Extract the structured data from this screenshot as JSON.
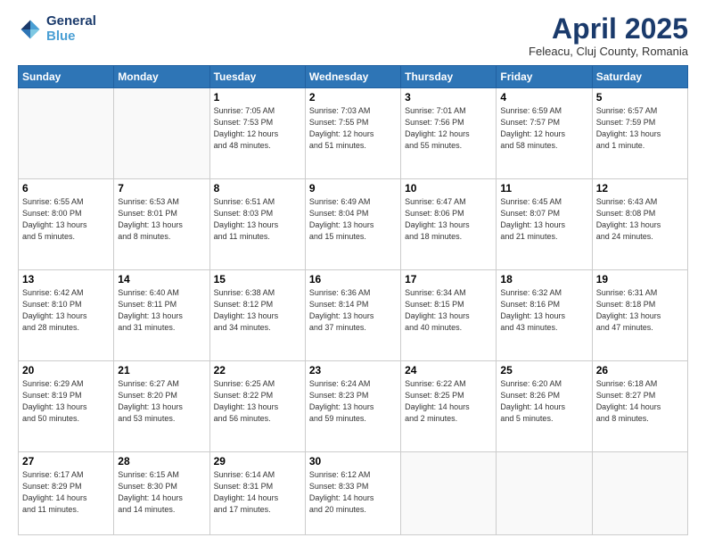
{
  "header": {
    "logo_line1": "General",
    "logo_line2": "Blue",
    "month_title": "April 2025",
    "location": "Feleacu, Cluj County, Romania"
  },
  "weekdays": [
    "Sunday",
    "Monday",
    "Tuesday",
    "Wednesday",
    "Thursday",
    "Friday",
    "Saturday"
  ],
  "weeks": [
    [
      {
        "day": "",
        "info": ""
      },
      {
        "day": "",
        "info": ""
      },
      {
        "day": "1",
        "info": "Sunrise: 7:05 AM\nSunset: 7:53 PM\nDaylight: 12 hours\nand 48 minutes."
      },
      {
        "day": "2",
        "info": "Sunrise: 7:03 AM\nSunset: 7:55 PM\nDaylight: 12 hours\nand 51 minutes."
      },
      {
        "day": "3",
        "info": "Sunrise: 7:01 AM\nSunset: 7:56 PM\nDaylight: 12 hours\nand 55 minutes."
      },
      {
        "day": "4",
        "info": "Sunrise: 6:59 AM\nSunset: 7:57 PM\nDaylight: 12 hours\nand 58 minutes."
      },
      {
        "day": "5",
        "info": "Sunrise: 6:57 AM\nSunset: 7:59 PM\nDaylight: 13 hours\nand 1 minute."
      }
    ],
    [
      {
        "day": "6",
        "info": "Sunrise: 6:55 AM\nSunset: 8:00 PM\nDaylight: 13 hours\nand 5 minutes."
      },
      {
        "day": "7",
        "info": "Sunrise: 6:53 AM\nSunset: 8:01 PM\nDaylight: 13 hours\nand 8 minutes."
      },
      {
        "day": "8",
        "info": "Sunrise: 6:51 AM\nSunset: 8:03 PM\nDaylight: 13 hours\nand 11 minutes."
      },
      {
        "day": "9",
        "info": "Sunrise: 6:49 AM\nSunset: 8:04 PM\nDaylight: 13 hours\nand 15 minutes."
      },
      {
        "day": "10",
        "info": "Sunrise: 6:47 AM\nSunset: 8:06 PM\nDaylight: 13 hours\nand 18 minutes."
      },
      {
        "day": "11",
        "info": "Sunrise: 6:45 AM\nSunset: 8:07 PM\nDaylight: 13 hours\nand 21 minutes."
      },
      {
        "day": "12",
        "info": "Sunrise: 6:43 AM\nSunset: 8:08 PM\nDaylight: 13 hours\nand 24 minutes."
      }
    ],
    [
      {
        "day": "13",
        "info": "Sunrise: 6:42 AM\nSunset: 8:10 PM\nDaylight: 13 hours\nand 28 minutes."
      },
      {
        "day": "14",
        "info": "Sunrise: 6:40 AM\nSunset: 8:11 PM\nDaylight: 13 hours\nand 31 minutes."
      },
      {
        "day": "15",
        "info": "Sunrise: 6:38 AM\nSunset: 8:12 PM\nDaylight: 13 hours\nand 34 minutes."
      },
      {
        "day": "16",
        "info": "Sunrise: 6:36 AM\nSunset: 8:14 PM\nDaylight: 13 hours\nand 37 minutes."
      },
      {
        "day": "17",
        "info": "Sunrise: 6:34 AM\nSunset: 8:15 PM\nDaylight: 13 hours\nand 40 minutes."
      },
      {
        "day": "18",
        "info": "Sunrise: 6:32 AM\nSunset: 8:16 PM\nDaylight: 13 hours\nand 43 minutes."
      },
      {
        "day": "19",
        "info": "Sunrise: 6:31 AM\nSunset: 8:18 PM\nDaylight: 13 hours\nand 47 minutes."
      }
    ],
    [
      {
        "day": "20",
        "info": "Sunrise: 6:29 AM\nSunset: 8:19 PM\nDaylight: 13 hours\nand 50 minutes."
      },
      {
        "day": "21",
        "info": "Sunrise: 6:27 AM\nSunset: 8:20 PM\nDaylight: 13 hours\nand 53 minutes."
      },
      {
        "day": "22",
        "info": "Sunrise: 6:25 AM\nSunset: 8:22 PM\nDaylight: 13 hours\nand 56 minutes."
      },
      {
        "day": "23",
        "info": "Sunrise: 6:24 AM\nSunset: 8:23 PM\nDaylight: 13 hours\nand 59 minutes."
      },
      {
        "day": "24",
        "info": "Sunrise: 6:22 AM\nSunset: 8:25 PM\nDaylight: 14 hours\nand 2 minutes."
      },
      {
        "day": "25",
        "info": "Sunrise: 6:20 AM\nSunset: 8:26 PM\nDaylight: 14 hours\nand 5 minutes."
      },
      {
        "day": "26",
        "info": "Sunrise: 6:18 AM\nSunset: 8:27 PM\nDaylight: 14 hours\nand 8 minutes."
      }
    ],
    [
      {
        "day": "27",
        "info": "Sunrise: 6:17 AM\nSunset: 8:29 PM\nDaylight: 14 hours\nand 11 minutes."
      },
      {
        "day": "28",
        "info": "Sunrise: 6:15 AM\nSunset: 8:30 PM\nDaylight: 14 hours\nand 14 minutes."
      },
      {
        "day": "29",
        "info": "Sunrise: 6:14 AM\nSunset: 8:31 PM\nDaylight: 14 hours\nand 17 minutes."
      },
      {
        "day": "30",
        "info": "Sunrise: 6:12 AM\nSunset: 8:33 PM\nDaylight: 14 hours\nand 20 minutes."
      },
      {
        "day": "",
        "info": ""
      },
      {
        "day": "",
        "info": ""
      },
      {
        "day": "",
        "info": ""
      }
    ]
  ]
}
